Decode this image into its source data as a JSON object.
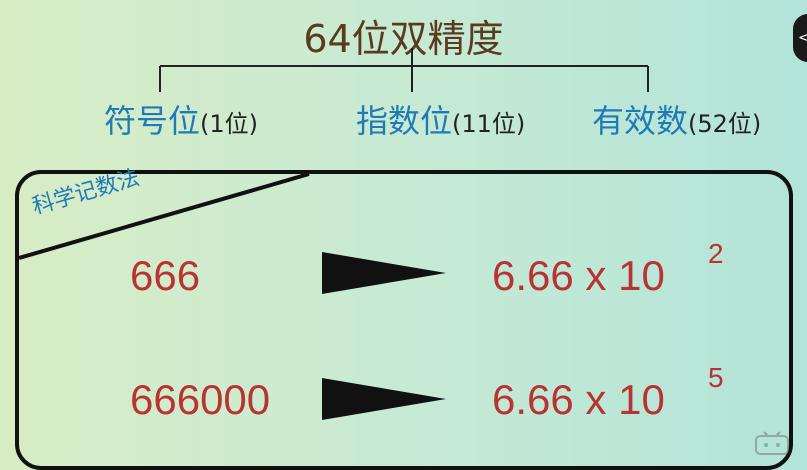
{
  "title": "64位双精度",
  "fields": [
    {
      "name": "符号位",
      "bits": "(1位)"
    },
    {
      "name": "指数位",
      "bits": "(11位)"
    },
    {
      "name": "有效数",
      "bits": "(52位)"
    }
  ],
  "box_label": "科学记数法",
  "examples": [
    {
      "input": "666",
      "mantissa": "6.66 x 10",
      "exponent": "2"
    },
    {
      "input": "666000",
      "mantissa": "6.66 x 10",
      "exponent": "5"
    }
  ],
  "corner_button_glyph": "<",
  "icons": [
    "arrow-right-icon",
    "collapse-icon",
    "watermark-icon"
  ],
  "colors": {
    "title": "#5a3b1e",
    "field": "#1f7ab5",
    "number": "#b83333",
    "border": "#111111"
  }
}
